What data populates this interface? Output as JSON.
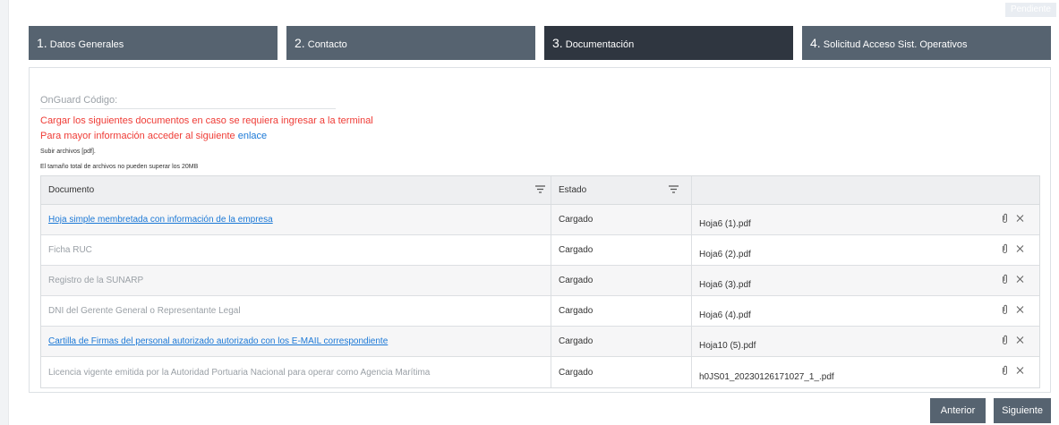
{
  "status": {
    "badge": "Pendiente"
  },
  "steps": [
    {
      "num": "1.",
      "label": "Datos Generales",
      "active": false
    },
    {
      "num": "2.",
      "label": "Contacto",
      "active": false
    },
    {
      "num": "3.",
      "label": "Documentación",
      "active": true
    },
    {
      "num": "4.",
      "label": "Solicitud Acceso Sist. Operativos",
      "active": false
    }
  ],
  "form": {
    "onguard_label": "OnGuard Código:",
    "notice_line1": "Cargar los siguientes documentos en caso se requiera ingresar a la terminal",
    "notice_line2_prefix": "Para mayor información acceder al siguiente ",
    "notice_link": "enlace",
    "upload_types": "Subir archivos [pdf].",
    "size_limit": "El tamaño total de archivos no pueden superar los 20MB"
  },
  "table": {
    "columns": {
      "document": "Documento",
      "state": "Estado"
    },
    "rows": [
      {
        "document": "Hoja simple membretada con información de la empresa",
        "link": true,
        "state": "Cargado",
        "file": "Hoja6 (1).pdf"
      },
      {
        "document": "Ficha RUC",
        "link": false,
        "state": "Cargado",
        "file": "Hoja6 (2).pdf"
      },
      {
        "document": "Registro de la SUNARP",
        "link": false,
        "state": "Cargado",
        "file": "Hoja6 (3).pdf"
      },
      {
        "document": "DNI del Gerente General o Representante Legal",
        "link": false,
        "state": "Cargado",
        "file": "Hoja6 (4).pdf"
      },
      {
        "document": "Cartilla de Firmas del personal autorizado autorizado con los E-MAIL correspondiente",
        "link": true,
        "state": "Cargado",
        "file": "Hoja10 (5).pdf"
      },
      {
        "document": "Licencia vigente emitida por la Autoridad Portuaria Nacional para operar como Agencia Marítima",
        "link": false,
        "state": "Cargado",
        "file": "h0JS01_20230126171027_1_.pdf"
      }
    ]
  },
  "buttons": {
    "previous": "Anterior",
    "next": "Siguiente"
  },
  "icons": {
    "sort": "filter-lines-icon",
    "attach": "paperclip-icon",
    "remove": "close-icon"
  }
}
